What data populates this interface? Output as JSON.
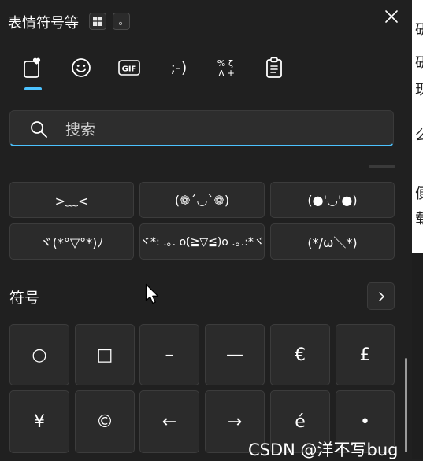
{
  "background": {
    "chars": [
      "研",
      "研",
      "现",
      "么",
      "便",
      "载"
    ]
  },
  "header": {
    "title": "表情符号等",
    "key_hint_1": "⊞",
    "key_hint_2": "。"
  },
  "tabs": [
    {
      "name": "favorites",
      "icon": "heart-clipboard-icon",
      "active": true
    },
    {
      "name": "emoji",
      "icon": "smiley-icon"
    },
    {
      "name": "gif",
      "icon": "gif-icon",
      "label": "GIF"
    },
    {
      "name": "kaomoji",
      "icon": "kaomoji-icon",
      "label": ";-)"
    },
    {
      "name": "symbols",
      "icon": "symbols-icon"
    },
    {
      "name": "clipboard",
      "icon": "clipboard-icon"
    }
  ],
  "search": {
    "placeholder": "搜索"
  },
  "kaomoji": [
    ">﹏<",
    "(❁´◡`❁)",
    "(●'◡'●)",
    "ヾ(*°▽°*)ﾉ",
    "ヾ*: .｡. o(≧▽≦)o .｡.:*ヾ",
    "(*/ω＼*)"
  ],
  "symbols_section": {
    "title": "符号",
    "more_label": "›",
    "items": [
      "○",
      "□",
      "–",
      "—",
      "€",
      "£",
      "¥",
      "©",
      "←",
      "→",
      "é",
      "•"
    ]
  },
  "watermark": "CSDN @洋不写bug",
  "accent_color": "#4cc2ff"
}
